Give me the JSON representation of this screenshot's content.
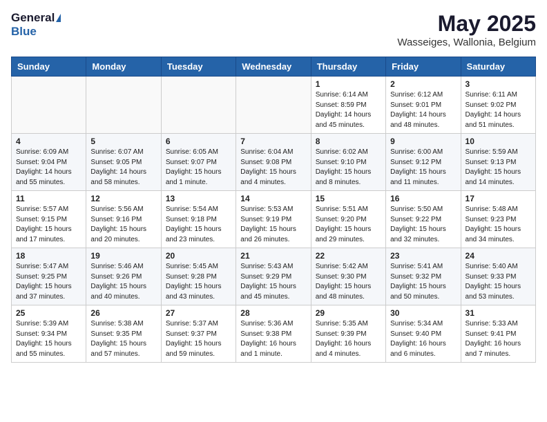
{
  "header": {
    "logo_general": "General",
    "logo_blue": "Blue",
    "month_year": "May 2025",
    "location": "Wasseiges, Wallonia, Belgium"
  },
  "days_of_week": [
    "Sunday",
    "Monday",
    "Tuesday",
    "Wednesday",
    "Thursday",
    "Friday",
    "Saturday"
  ],
  "weeks": [
    {
      "days": [
        {
          "number": "",
          "info": ""
        },
        {
          "number": "",
          "info": ""
        },
        {
          "number": "",
          "info": ""
        },
        {
          "number": "",
          "info": ""
        },
        {
          "number": "1",
          "info": "Sunrise: 6:14 AM\nSunset: 8:59 PM\nDaylight: 14 hours\nand 45 minutes."
        },
        {
          "number": "2",
          "info": "Sunrise: 6:12 AM\nSunset: 9:01 PM\nDaylight: 14 hours\nand 48 minutes."
        },
        {
          "number": "3",
          "info": "Sunrise: 6:11 AM\nSunset: 9:02 PM\nDaylight: 14 hours\nand 51 minutes."
        }
      ]
    },
    {
      "days": [
        {
          "number": "4",
          "info": "Sunrise: 6:09 AM\nSunset: 9:04 PM\nDaylight: 14 hours\nand 55 minutes."
        },
        {
          "number": "5",
          "info": "Sunrise: 6:07 AM\nSunset: 9:05 PM\nDaylight: 14 hours\nand 58 minutes."
        },
        {
          "number": "6",
          "info": "Sunrise: 6:05 AM\nSunset: 9:07 PM\nDaylight: 15 hours\nand 1 minute."
        },
        {
          "number": "7",
          "info": "Sunrise: 6:04 AM\nSunset: 9:08 PM\nDaylight: 15 hours\nand 4 minutes."
        },
        {
          "number": "8",
          "info": "Sunrise: 6:02 AM\nSunset: 9:10 PM\nDaylight: 15 hours\nand 8 minutes."
        },
        {
          "number": "9",
          "info": "Sunrise: 6:00 AM\nSunset: 9:12 PM\nDaylight: 15 hours\nand 11 minutes."
        },
        {
          "number": "10",
          "info": "Sunrise: 5:59 AM\nSunset: 9:13 PM\nDaylight: 15 hours\nand 14 minutes."
        }
      ]
    },
    {
      "days": [
        {
          "number": "11",
          "info": "Sunrise: 5:57 AM\nSunset: 9:15 PM\nDaylight: 15 hours\nand 17 minutes."
        },
        {
          "number": "12",
          "info": "Sunrise: 5:56 AM\nSunset: 9:16 PM\nDaylight: 15 hours\nand 20 minutes."
        },
        {
          "number": "13",
          "info": "Sunrise: 5:54 AM\nSunset: 9:18 PM\nDaylight: 15 hours\nand 23 minutes."
        },
        {
          "number": "14",
          "info": "Sunrise: 5:53 AM\nSunset: 9:19 PM\nDaylight: 15 hours\nand 26 minutes."
        },
        {
          "number": "15",
          "info": "Sunrise: 5:51 AM\nSunset: 9:20 PM\nDaylight: 15 hours\nand 29 minutes."
        },
        {
          "number": "16",
          "info": "Sunrise: 5:50 AM\nSunset: 9:22 PM\nDaylight: 15 hours\nand 32 minutes."
        },
        {
          "number": "17",
          "info": "Sunrise: 5:48 AM\nSunset: 9:23 PM\nDaylight: 15 hours\nand 34 minutes."
        }
      ]
    },
    {
      "days": [
        {
          "number": "18",
          "info": "Sunrise: 5:47 AM\nSunset: 9:25 PM\nDaylight: 15 hours\nand 37 minutes."
        },
        {
          "number": "19",
          "info": "Sunrise: 5:46 AM\nSunset: 9:26 PM\nDaylight: 15 hours\nand 40 minutes."
        },
        {
          "number": "20",
          "info": "Sunrise: 5:45 AM\nSunset: 9:28 PM\nDaylight: 15 hours\nand 43 minutes."
        },
        {
          "number": "21",
          "info": "Sunrise: 5:43 AM\nSunset: 9:29 PM\nDaylight: 15 hours\nand 45 minutes."
        },
        {
          "number": "22",
          "info": "Sunrise: 5:42 AM\nSunset: 9:30 PM\nDaylight: 15 hours\nand 48 minutes."
        },
        {
          "number": "23",
          "info": "Sunrise: 5:41 AM\nSunset: 9:32 PM\nDaylight: 15 hours\nand 50 minutes."
        },
        {
          "number": "24",
          "info": "Sunrise: 5:40 AM\nSunset: 9:33 PM\nDaylight: 15 hours\nand 53 minutes."
        }
      ]
    },
    {
      "days": [
        {
          "number": "25",
          "info": "Sunrise: 5:39 AM\nSunset: 9:34 PM\nDaylight: 15 hours\nand 55 minutes."
        },
        {
          "number": "26",
          "info": "Sunrise: 5:38 AM\nSunset: 9:35 PM\nDaylight: 15 hours\nand 57 minutes."
        },
        {
          "number": "27",
          "info": "Sunrise: 5:37 AM\nSunset: 9:37 PM\nDaylight: 15 hours\nand 59 minutes."
        },
        {
          "number": "28",
          "info": "Sunrise: 5:36 AM\nSunset: 9:38 PM\nDaylight: 16 hours\nand 1 minute."
        },
        {
          "number": "29",
          "info": "Sunrise: 5:35 AM\nSunset: 9:39 PM\nDaylight: 16 hours\nand 4 minutes."
        },
        {
          "number": "30",
          "info": "Sunrise: 5:34 AM\nSunset: 9:40 PM\nDaylight: 16 hours\nand 6 minutes."
        },
        {
          "number": "31",
          "info": "Sunrise: 5:33 AM\nSunset: 9:41 PM\nDaylight: 16 hours\nand 7 minutes."
        }
      ]
    }
  ]
}
